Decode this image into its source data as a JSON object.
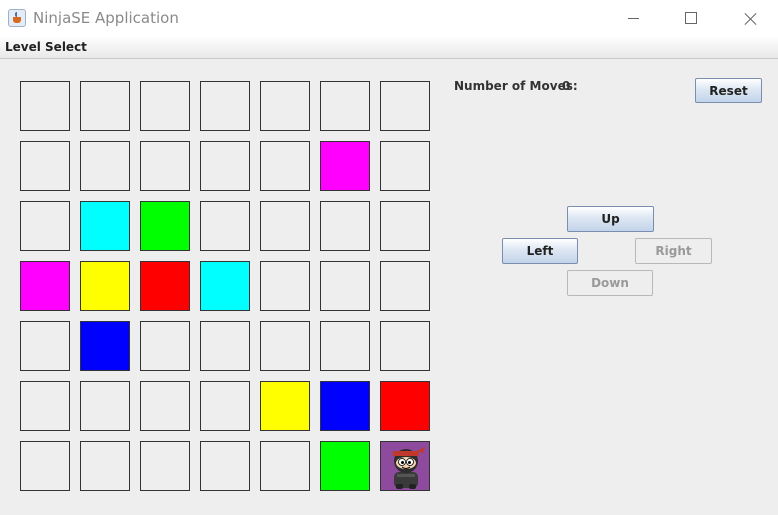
{
  "window": {
    "title": "NinjaSE Application"
  },
  "menu": {
    "items": [
      "Level Select"
    ]
  },
  "status": {
    "moves_label": "Number of Moves:",
    "moves_value": "0"
  },
  "controls": {
    "reset_label": "Reset",
    "up_label": "Up",
    "left_label": "Left",
    "right_label": "Right",
    "down_label": "Down",
    "right_enabled": false,
    "down_enabled": false
  },
  "colors": {
    "empty": "#eeeeee",
    "magenta": "#ff00ff",
    "cyan": "#00ffff",
    "green": "#00ff00",
    "yellow": "#ffff00",
    "red": "#ff0000",
    "blue": "#0000ff",
    "ninja_bg": "#8e4a9d"
  },
  "board": {
    "rows": 7,
    "cols": 7,
    "cells": [
      [
        "empty",
        "empty",
        "empty",
        "empty",
        "empty",
        "empty",
        "empty"
      ],
      [
        "empty",
        "empty",
        "empty",
        "empty",
        "empty",
        "magenta",
        "empty"
      ],
      [
        "empty",
        "cyan",
        "green",
        "empty",
        "empty",
        "empty",
        "empty"
      ],
      [
        "magenta",
        "yellow",
        "red",
        "cyan",
        "empty",
        "empty",
        "empty"
      ],
      [
        "empty",
        "blue",
        "empty",
        "empty",
        "empty",
        "empty",
        "empty"
      ],
      [
        "empty",
        "empty",
        "empty",
        "empty",
        "yellow",
        "blue",
        "red"
      ],
      [
        "empty",
        "empty",
        "empty",
        "empty",
        "empty",
        "green",
        "ninja"
      ]
    ]
  }
}
